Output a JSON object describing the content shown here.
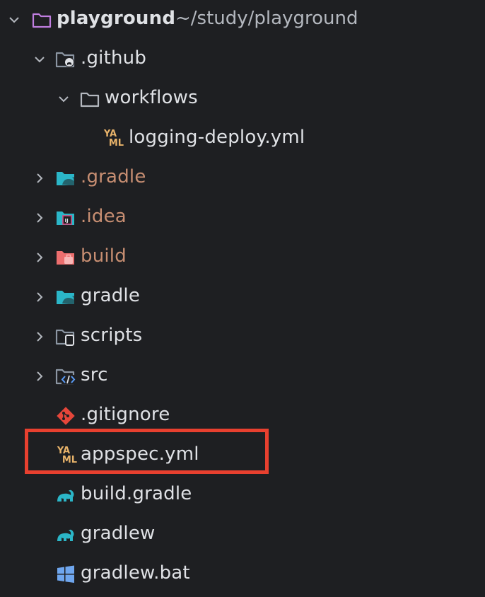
{
  "project": {
    "name": "playground",
    "path": "~/study/playground"
  },
  "items": [
    {
      "label": ".github"
    },
    {
      "label": "workflows"
    },
    {
      "label": "logging-deploy.yml"
    },
    {
      "label": ".gradle"
    },
    {
      "label": ".idea"
    },
    {
      "label": "build"
    },
    {
      "label": "gradle"
    },
    {
      "label": "scripts"
    },
    {
      "label": "src"
    },
    {
      "label": ".gitignore"
    },
    {
      "label": "appspec.yml"
    },
    {
      "label": "build.gradle"
    },
    {
      "label": "gradlew"
    },
    {
      "label": "gradlew.bat"
    }
  ],
  "yaml_badge": {
    "top": "YA",
    "bottom": "ML"
  },
  "colors": {
    "background": "#1e1f22",
    "text": "#dfe1e5",
    "excluded": "#c78e72",
    "highlight": "#e8402f",
    "folder_purple": "#c07ee0",
    "gradle_teal": "#2bb6c8"
  }
}
